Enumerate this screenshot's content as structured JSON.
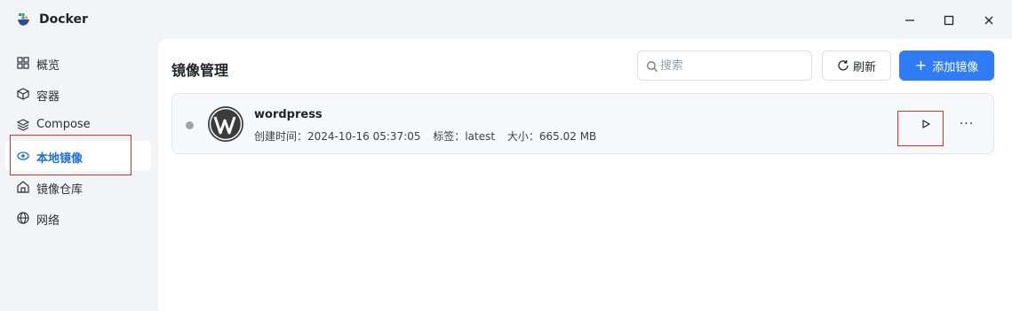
{
  "app": {
    "title": "Docker",
    "logo_icon": "docker-whale-icon"
  },
  "window_controls": {
    "minimize_icon": "minimize-icon",
    "maximize_icon": "maximize-icon",
    "close_icon": "close-icon"
  },
  "sidebar": {
    "items": [
      {
        "label": "概览",
        "icon": "grid-icon",
        "active": false
      },
      {
        "label": "容器",
        "icon": "cube-icon",
        "active": false
      },
      {
        "label": "Compose",
        "icon": "layers-icon",
        "active": false
      },
      {
        "label": "本地镜像",
        "icon": "eye-icon",
        "active": true
      },
      {
        "label": "镜像仓库",
        "icon": "home-icon",
        "active": false
      },
      {
        "label": "网络",
        "icon": "globe-icon",
        "active": false
      }
    ]
  },
  "main": {
    "title": "镜像管理",
    "search": {
      "placeholder": "搜索",
      "value": ""
    },
    "refresh_label": "刷新",
    "add_label": "添加镜像",
    "images": [
      {
        "name": "wordpress",
        "created_label": "创建时间：",
        "created": "2024-10-16 05:37:05",
        "tag_label": "标签：",
        "tag": "latest",
        "size_label": "大小：",
        "size": "665.02 MB",
        "status": "stopped",
        "logo_icon": "wordpress-logo-icon"
      }
    ]
  },
  "colors": {
    "accent": "#2f7cf6",
    "active_text": "#1e6fd9",
    "highlight": "#e0302f"
  }
}
